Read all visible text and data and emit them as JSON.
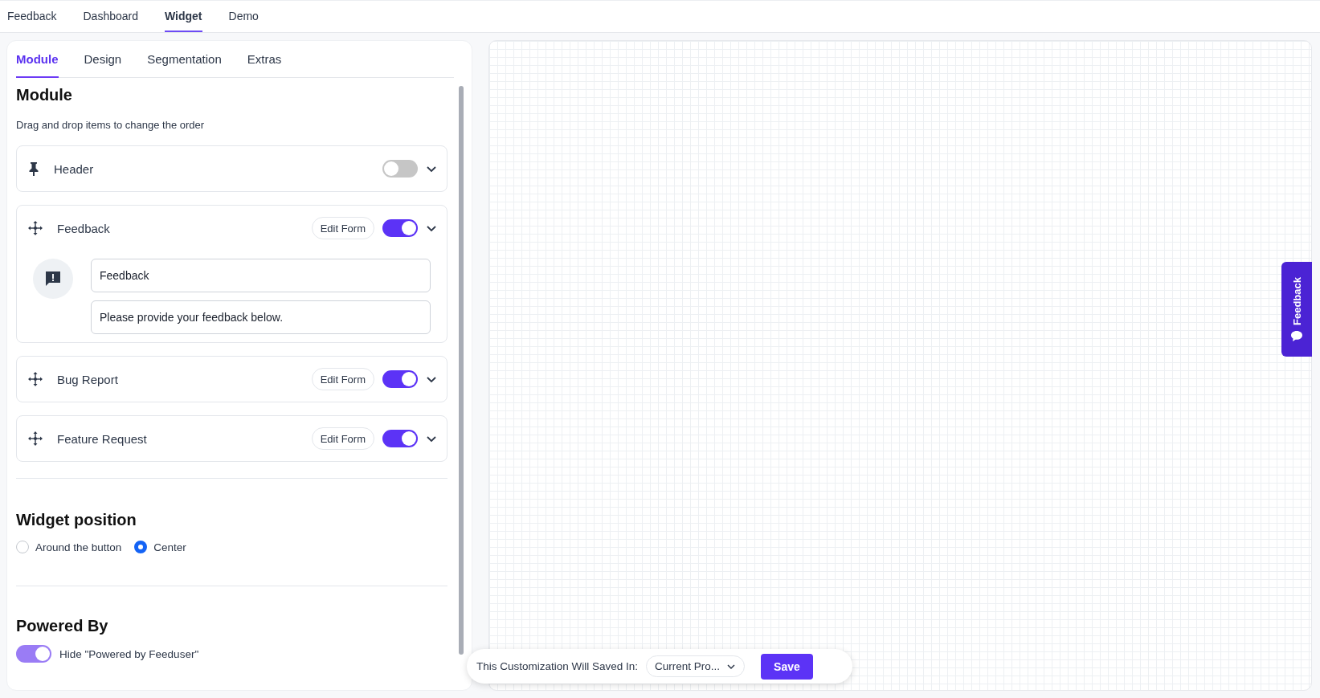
{
  "nav_tabs": [
    {
      "label": "Feedback",
      "selected": false
    },
    {
      "label": "Dashboard",
      "selected": false
    },
    {
      "label": "Widget",
      "selected": true
    },
    {
      "label": "Demo",
      "selected": false
    }
  ],
  "panel_tabs": [
    {
      "label": "Module",
      "selected": true
    },
    {
      "label": "Design",
      "selected": false
    },
    {
      "label": "Segmentation",
      "selected": false
    },
    {
      "label": "Extras",
      "selected": false
    }
  ],
  "module": {
    "title": "Module",
    "hint": "Drag and drop items to change the order",
    "items": [
      {
        "kind": "pinned",
        "label": "Header",
        "on": false
      },
      {
        "kind": "draggable",
        "label": "Feedback",
        "edit_button": "Edit Form",
        "on": true,
        "fields": [
          "Feedback",
          "Please provide your feedback below."
        ]
      },
      {
        "kind": "draggable",
        "label": "Bug Report",
        "edit_button": "Edit Form",
        "on": true
      },
      {
        "kind": "draggable",
        "label": "Feature Request",
        "edit_button": "Edit Form",
        "on": true
      }
    ]
  },
  "widget_position": {
    "title": "Widget position",
    "options": [
      {
        "label": "Around the button",
        "selected": false
      },
      {
        "label": "Center",
        "selected": true
      }
    ]
  },
  "powered_by": {
    "title": "Powered By",
    "toggle": {
      "label": "Hide \"Powered by Feeduser\"",
      "on": true
    }
  },
  "save_bar": {
    "label": "This Customization Will Saved In:",
    "select": "Current Pro...",
    "button": "Save"
  },
  "side_tab": {
    "label": "Feedback"
  }
}
